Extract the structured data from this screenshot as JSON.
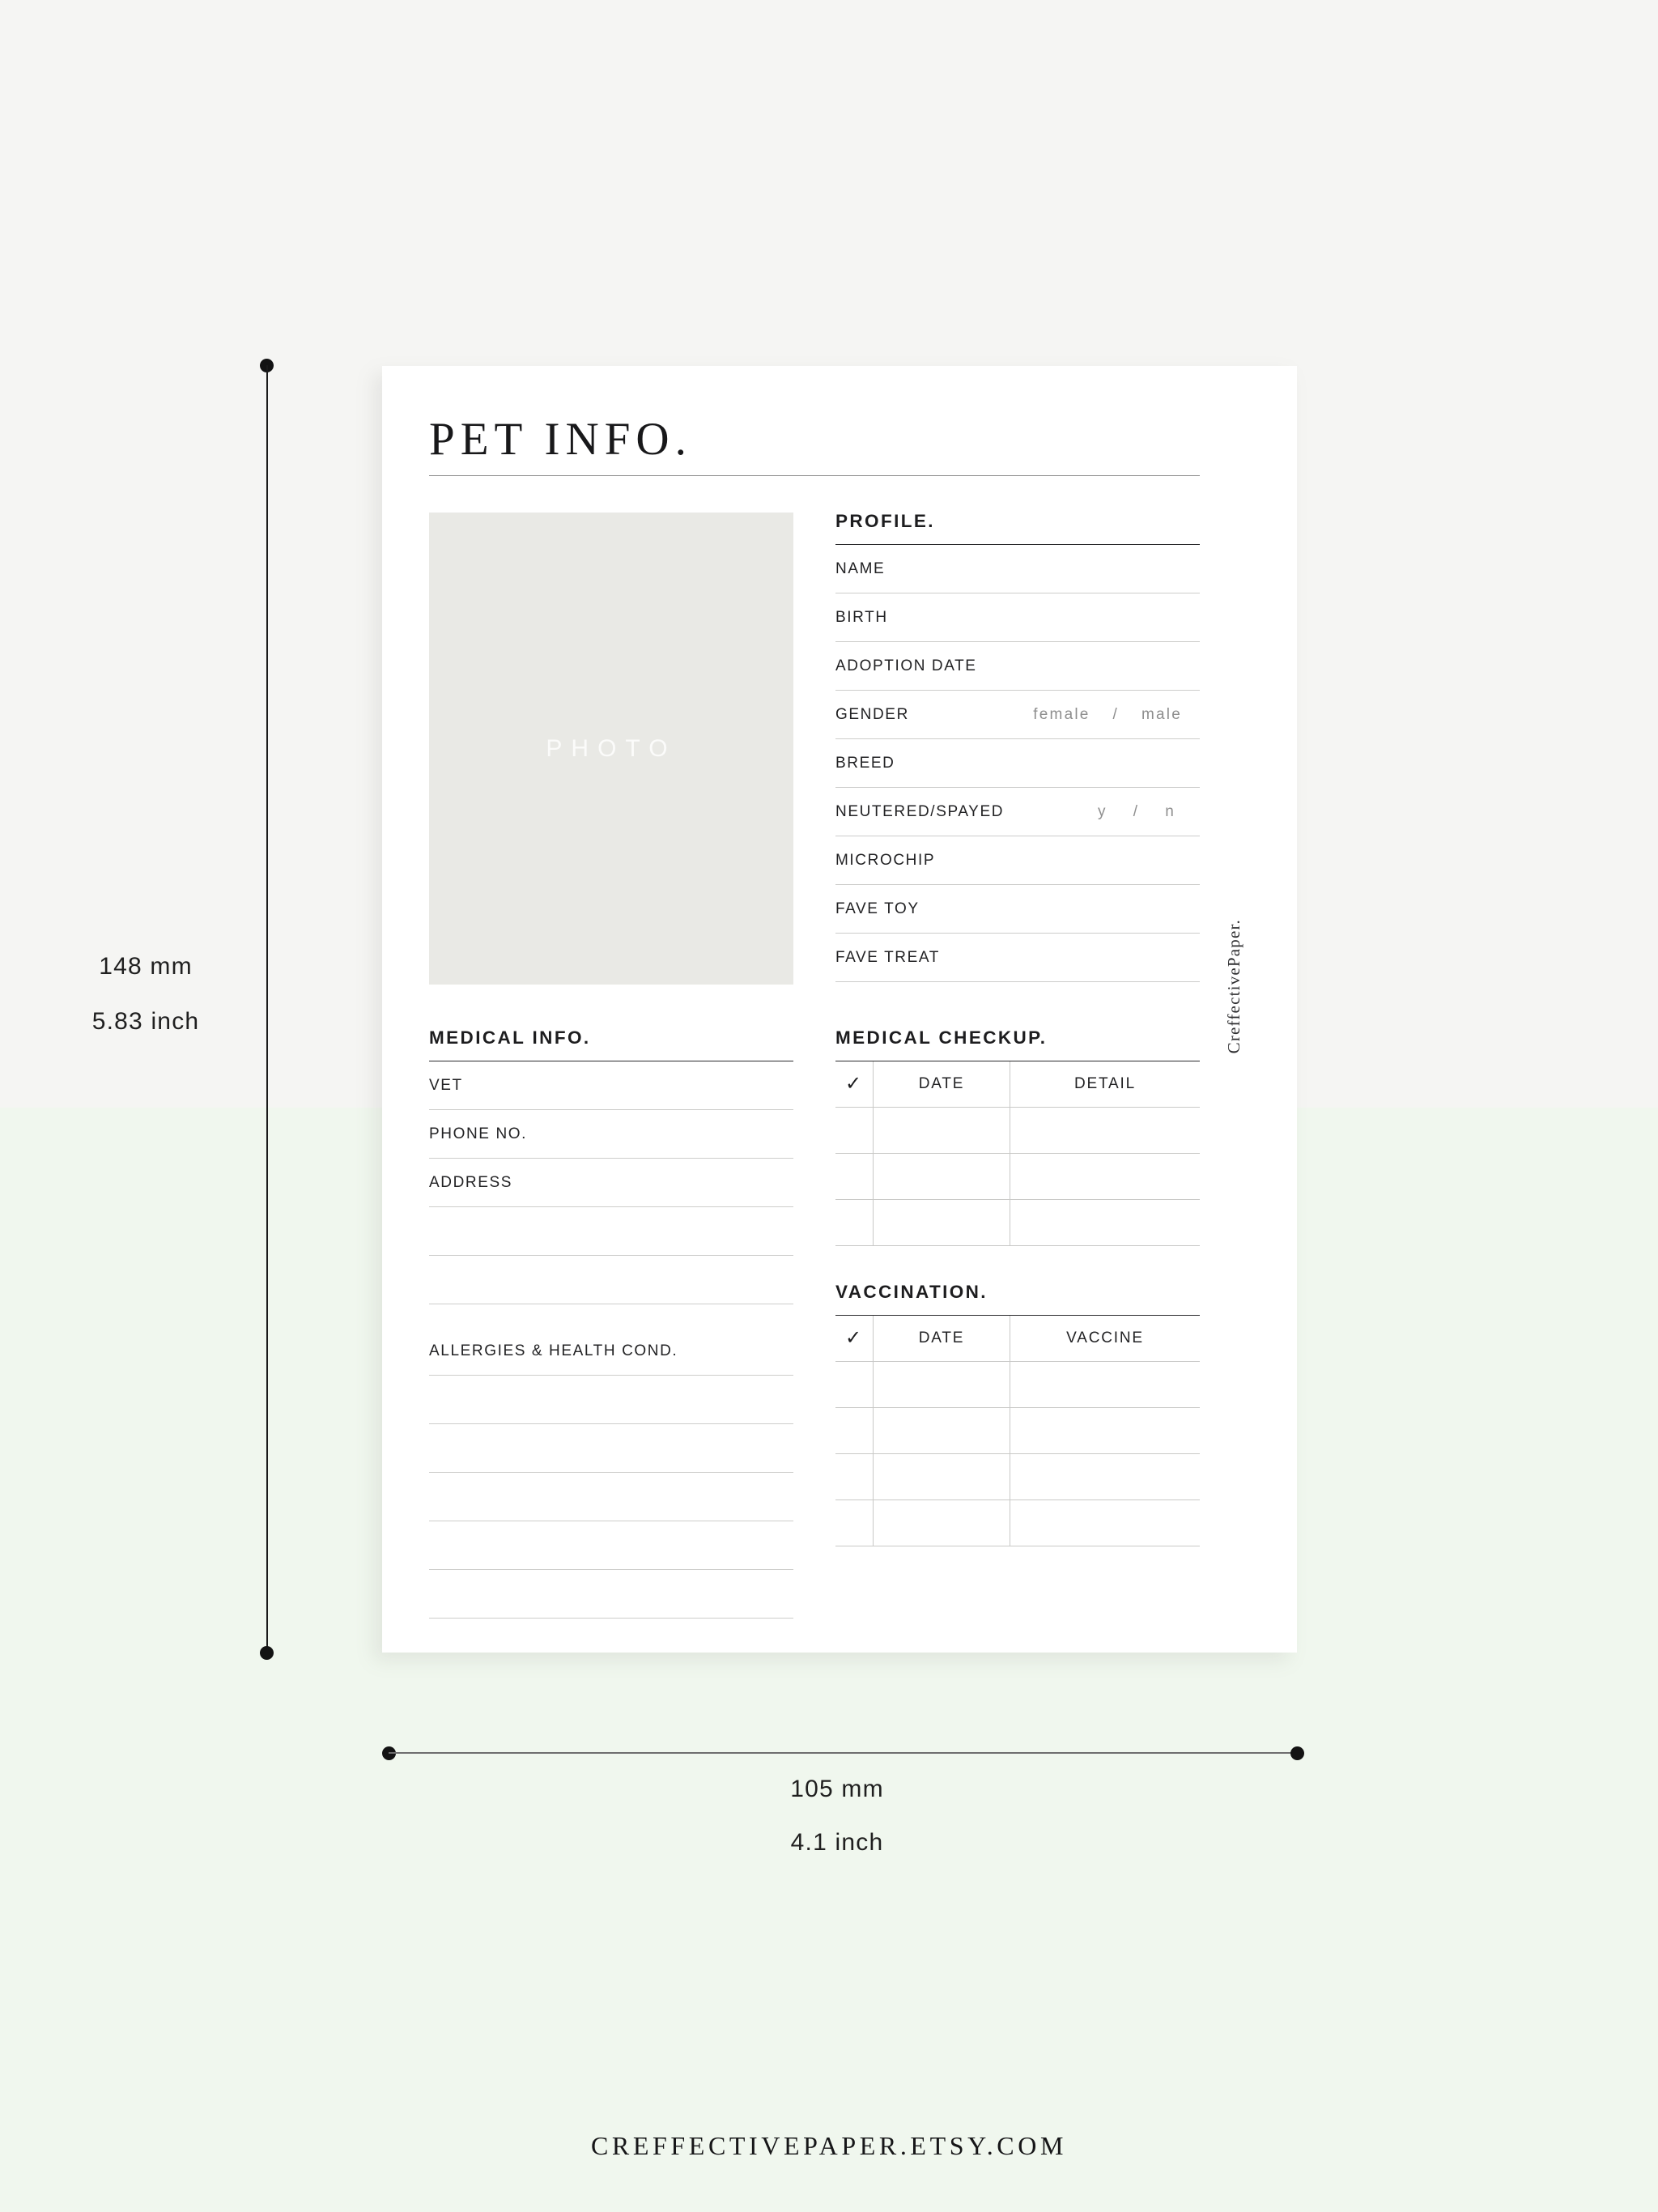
{
  "background": {
    "top_color": "#f5f5f3",
    "bottom_color": "#f0f7ee"
  },
  "card": {
    "title": "PET INFO.",
    "photo_placeholder": "PHOTO",
    "watermark": "CreffectivePaper.",
    "profile": {
      "heading": "PROFILE.",
      "fields": [
        {
          "label": "NAME",
          "options": []
        },
        {
          "label": "BIRTH",
          "options": []
        },
        {
          "label": "ADOPTION DATE",
          "options": []
        },
        {
          "label": "GENDER",
          "options": [
            "female",
            "/",
            "male"
          ]
        },
        {
          "label": "BREED",
          "options": []
        },
        {
          "label": "NEUTERED/SPAYED",
          "options": [
            "y",
            "/",
            "n"
          ]
        },
        {
          "label": "MICROCHIP",
          "options": []
        },
        {
          "label": "FAVE TOY",
          "options": []
        },
        {
          "label": "FAVE TREAT",
          "options": []
        }
      ]
    },
    "medical_info": {
      "heading": "MEDICAL INFO.",
      "fields": [
        {
          "label": "VET"
        },
        {
          "label": "PHONE NO."
        },
        {
          "label": "ADDRESS"
        },
        {
          "label": ""
        },
        {
          "label": ""
        }
      ]
    },
    "allergies": {
      "heading": "ALLERGIES & HEALTH COND.",
      "blank_lines": 5
    },
    "medical_checkup": {
      "heading": "MEDICAL CHECKUP.",
      "columns": [
        "✓",
        "DATE",
        "DETAIL"
      ],
      "rows": [
        [
          "",
          "",
          ""
        ],
        [
          "",
          "",
          ""
        ],
        [
          "",
          "",
          ""
        ]
      ]
    },
    "vaccination": {
      "heading": "VACCINATION.",
      "columns": [
        "✓",
        "DATE",
        "VACCINE"
      ],
      "rows": [
        [
          "",
          "",
          ""
        ],
        [
          "",
          "",
          ""
        ],
        [
          "",
          "",
          ""
        ],
        [
          "",
          "",
          ""
        ]
      ]
    }
  },
  "dimensions": {
    "height_mm": "148 mm",
    "height_inch": "5.83 inch",
    "width_mm": "105 mm",
    "width_inch": "4.1 inch"
  },
  "footer": {
    "url": "CREFFECTIVEPAPER.ETSY.COM"
  }
}
